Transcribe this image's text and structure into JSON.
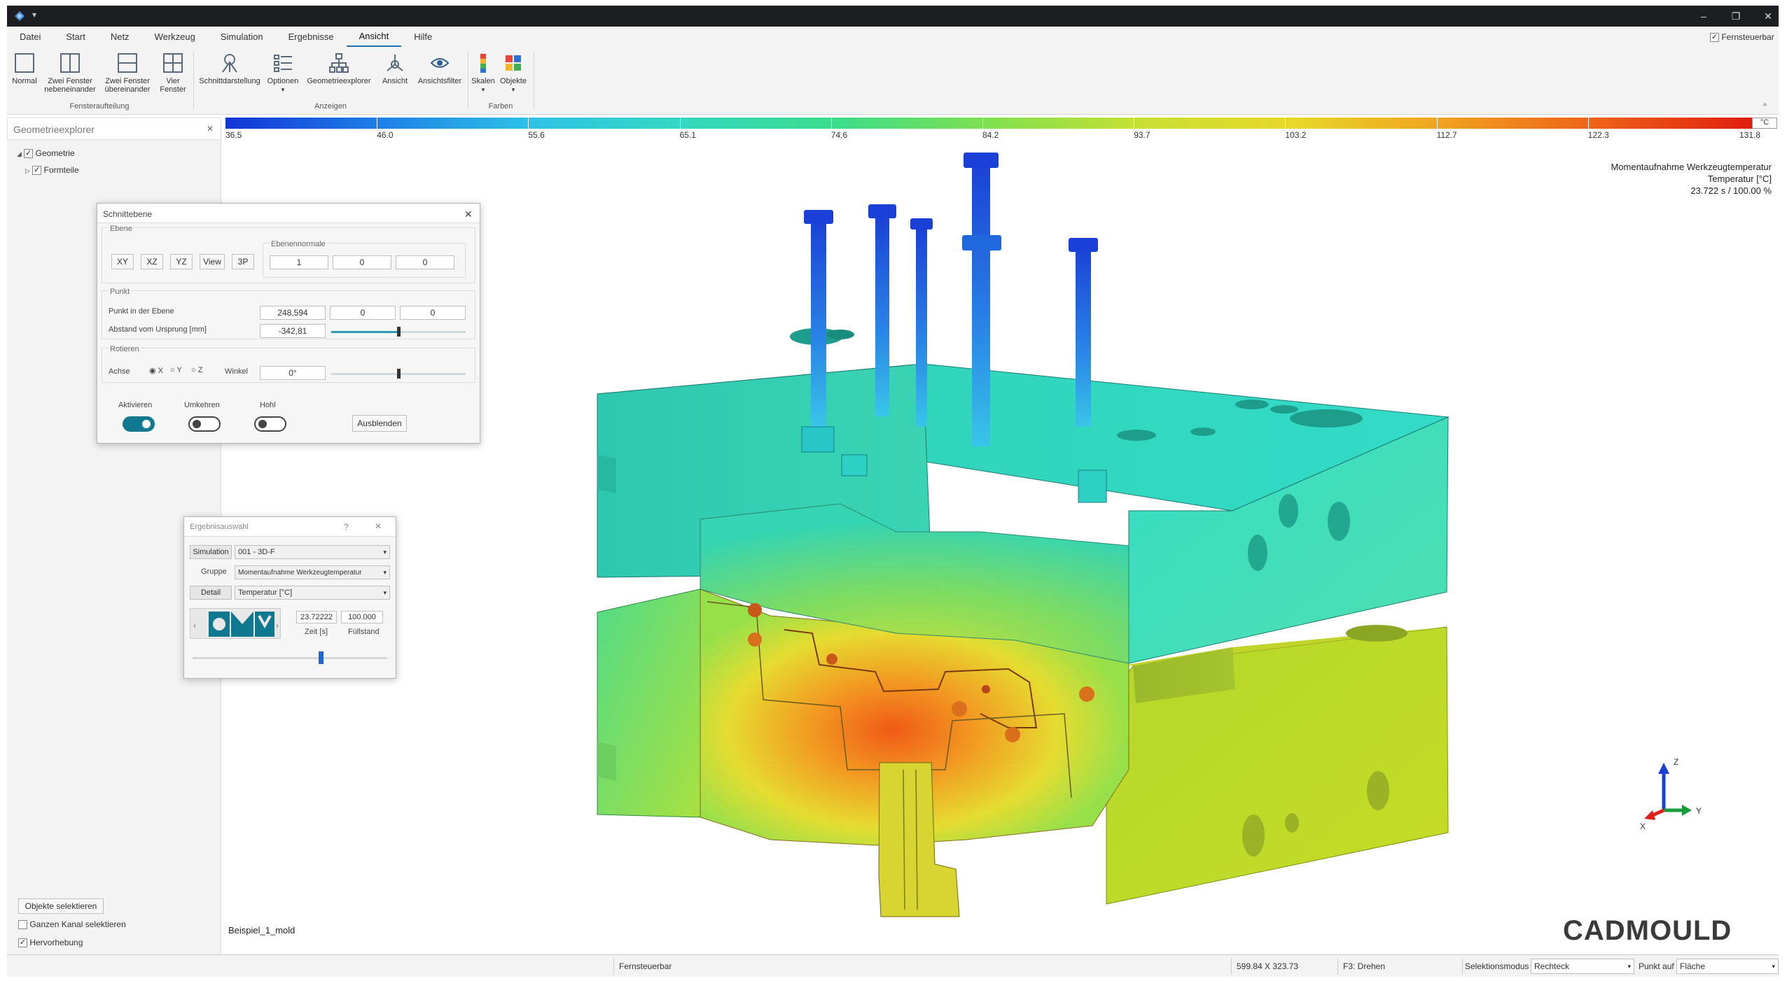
{
  "window": {
    "controls": {
      "minimize": "–",
      "restore": "❐",
      "close": "✕"
    }
  },
  "menu": [
    "Datei",
    "Start",
    "Netz",
    "Werkzeug",
    "Simulation",
    "Ergebnisse",
    "Ansicht",
    "Hilfe"
  ],
  "menu_active": "Ansicht",
  "remote": {
    "label": "Fernsteuerbar",
    "checked": true
  },
  "ribbon": {
    "window_buttons": [
      {
        "label1": "Normal",
        "label2": ""
      },
      {
        "label1": "Zwei Fenster",
        "label2": "nebeneinander"
      },
      {
        "label1": "Zwei Fenster",
        "label2": "übereinander"
      },
      {
        "label1": "Vier",
        "label2": "Fenster"
      }
    ],
    "display_buttons": [
      "Schnittdarstellung",
      "Optionen",
      "Geometrieexplorer",
      "Ansicht",
      "Ansichtsfilter"
    ],
    "color_buttons": [
      "Skalen",
      "Objekte"
    ],
    "groups": {
      "window_layout": "Fensteraufteilung",
      "display": "Anzeigen",
      "colors": "Farben"
    }
  },
  "explorer": {
    "title": "Geometrieexplorer",
    "close": "✕",
    "tree": [
      {
        "label": "Geometrie",
        "checked": true,
        "expanded": true
      },
      {
        "label": "Formteile",
        "checked": true,
        "expanded": false
      }
    ],
    "select_button": "Objekte selektieren",
    "options": [
      {
        "label": "Ganzen Kanal selektieren",
        "checked": false
      },
      {
        "label": "Hervorhebung",
        "checked": true
      }
    ]
  },
  "colorbar": {
    "unit": "°C",
    "ticks": [
      "36.5",
      "46.0",
      "55.6",
      "65.1",
      "74.6",
      "84.2",
      "93.7",
      "103.2",
      "112.7",
      "122.3",
      "131.8"
    ],
    "colors": [
      "#1235d6",
      "#1e7fe6",
      "#2ec2e6",
      "#35d8c0",
      "#3cdc8c",
      "#80e050",
      "#c8e034",
      "#e8d82a",
      "#f0a020",
      "#ee6018",
      "#e01e10"
    ]
  },
  "result_info": {
    "line1": "Momentaufnahme Werkzeugtemperatur",
    "line2": "Temperatur [°C]",
    "line3": "23.722 s  /  100.00 %"
  },
  "model_name": "Beispiel_1_mold",
  "brand": "CADMOULD",
  "axes": {
    "z": "Z",
    "y": "Y",
    "x": "X"
  },
  "section_dialog": {
    "title": "Schnittebene",
    "close": "✕",
    "plane_label": "Ebene",
    "plane_buttons": [
      "XY",
      "XZ",
      "YZ",
      "View",
      "3P"
    ],
    "normal_label": "Ebenennormale",
    "normal_values": [
      "1",
      "0",
      "0"
    ],
    "point_label": "Punkt",
    "point_in_plane_label": "Punkt in der Ebene",
    "point_values": [
      "248,594",
      "0",
      "0"
    ],
    "distance_label": "Abstand vom Ursprung [mm]",
    "distance_value": "-342,81",
    "distance_fraction": 0.5,
    "rotate_label": "Rotieren",
    "axis_label": "Achse",
    "axis_options": [
      "X",
      "Y",
      "Z"
    ],
    "axis_selected": "X",
    "angle_label": "Winkel",
    "angle_value": "0°",
    "angle_fraction": 0.5,
    "toggles": [
      {
        "label": "Aktivieren",
        "on": true
      },
      {
        "label": "Umkehren",
        "on": false
      },
      {
        "label": "Hohl",
        "on": false
      }
    ],
    "hide_button": "Ausblenden"
  },
  "result_dialog": {
    "title": "Ergebnisauswahl",
    "help": "?",
    "close": "✕",
    "simulation_label": "Simulation",
    "simulation_value": "001 - 3D-F",
    "group_label": "Gruppe",
    "group_value": "Momentaufnahme Werkzeugtemperatur",
    "detail_label": "Detail",
    "detail_value": "Temperatur [°C]",
    "time_value": "23.72222",
    "fill_value": "100.000",
    "time_label": "Zeit [s]",
    "fill_label": "Füllstand",
    "slider_fraction": 0.66
  },
  "status": {
    "remote": "Fernsteuerbar",
    "size": "599.84 X 323.73",
    "hint": "F3: Drehen",
    "selection_mode_label": "Selektionsmodus",
    "selection_mode_value": "Rechteck",
    "point_on_label": "Punkt auf",
    "point_on_value": "Fläche"
  }
}
